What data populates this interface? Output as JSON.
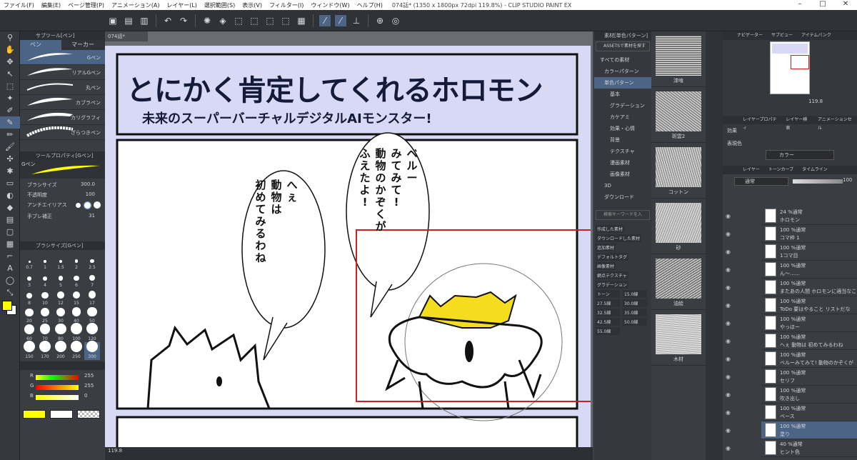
{
  "window": {
    "title": "074話* (1350 x 1800px 72dpi 119.8%) - CLIP STUDIO PAINT EX",
    "menu": [
      "ファイル(F)",
      "編集(E)",
      "ページ管理(P)",
      "アニメーション(A)",
      "レイヤー(L)",
      "選択範囲(S)",
      "表示(V)",
      "フィルター(I)",
      "ウィンドウ(W)",
      "ヘルプ(H)"
    ]
  },
  "subtool": {
    "tab_label": "サブツール[ペン]",
    "tabs": [
      "ペン",
      "マーカー"
    ],
    "brushes": [
      "Gペン",
      "リアルGペン",
      "丸ペン",
      "カブラペン",
      "カリグラフィ",
      "ざらつきペン"
    ]
  },
  "toolprop": {
    "header": "ツールプロパティ[Gペン]",
    "name": "Gペン",
    "rows": [
      {
        "label": "ブラシサイズ",
        "value": "300.0"
      },
      {
        "label": "不透明度",
        "value": "100"
      },
      {
        "label": "アンチエイリアス",
        "value": ""
      },
      {
        "label": "手ブレ補正",
        "value": "31"
      }
    ]
  },
  "brushsize": {
    "header": "ブラシサイズ[Gペン]",
    "sizes": [
      "0.7",
      "1",
      "1.5",
      "2",
      "2.5",
      "3",
      "4",
      "5",
      "6",
      "7",
      "8",
      "10",
      "12",
      "15",
      "17",
      "20",
      "25",
      "30",
      "40",
      "50",
      "60",
      "70",
      "80",
      "100",
      "120",
      "150",
      "170",
      "200",
      "250",
      "300"
    ]
  },
  "color": {
    "r_label": "R",
    "g_label": "G",
    "b_label": "B",
    "r": "255",
    "g": "255",
    "b": "0",
    "main": "#ffff00"
  },
  "canvas": {
    "tab": "074話*",
    "zoom": "119.8",
    "manga_title": "とにかく肯定してくれるホロモン",
    "manga_subtitle": "未来のスーパーバーチャルデジタルAIモンスター!",
    "bubble_left_lines": [
      "へぇ",
      "動物は",
      "初めてみるわね"
    ],
    "bubble_right_lines": [
      "ベルー",
      "みてみて!",
      "動物のかぞくが",
      "ふえたよ!"
    ]
  },
  "material": {
    "header": "素材[単色パターン]",
    "search_btn": "ASSETSで素材を探す",
    "tree": [
      "すべての素材",
      "カラーパターン",
      "単色パターン",
      "基本",
      "グラデーション",
      "カケアミ",
      "効果・心情",
      "背景",
      "テクスチャ",
      "漫画素材",
      "画像素材",
      "3D",
      "ダウンロード"
    ],
    "search_placeholder": "検索キーワードを入",
    "tags": [
      "作成した素材",
      "ダウンロードした素材",
      "追加素材",
      "デフォルトタグ",
      "画像素材",
      "網点テクスチャ",
      "グラデーション",
      "トーン",
      "15.0線",
      "27.5線",
      "30.0線",
      "32.5線",
      "35.0線",
      "42.5線",
      "50.0線",
      "55.0線"
    ],
    "items": [
      "漆喰",
      "斑雲2",
      "コットン",
      "砂",
      "油絵",
      "木材"
    ]
  },
  "navigator": {
    "tabs": [
      "ナビゲーター",
      "サブビュー",
      "アイテムバンク"
    ],
    "zoom": "119.8"
  },
  "layerprop": {
    "tabs": [
      "レイヤープロパティ",
      "レイヤー検索",
      "アニメーションセル"
    ],
    "effect": "効果",
    "color_label": "表現色",
    "color_value": "カラー"
  },
  "layers": {
    "tabs": [
      "レイヤー",
      "トーンカーブ",
      "タイムライン"
    ],
    "blend": "通常",
    "opacity": "100",
    "items": [
      {
        "a": "24 %通常",
        "b": "ホロモン"
      },
      {
        "a": "100 %通常",
        "b": "コマ枠 1"
      },
      {
        "a": "100 %通常",
        "b": "1コマ目"
      },
      {
        "a": "100 %通常",
        "b": "ん〜……"
      },
      {
        "a": "100 %通常",
        "b": "またあの人間 ホロモンに適当なこと教えて"
      },
      {
        "a": "100 %通常",
        "b": "ToDo 要はやること リストだな"
      },
      {
        "a": "100 %通常",
        "b": "やっほー"
      },
      {
        "a": "100 %通常",
        "b": "へぇ 動物は 初めてみるわね"
      },
      {
        "a": "100 %通常",
        "b": "ベルーみてみて! 動物のかぞくが ふえたよ!"
      },
      {
        "a": "100 %通常",
        "b": "セリフ"
      },
      {
        "a": "100 %通常",
        "b": "吹き出し"
      },
      {
        "a": "100 %通常",
        "b": "ベース"
      },
      {
        "a": "100 %通常",
        "b": "塗り"
      },
      {
        "a": "40 %通常",
        "b": "ヒント色"
      }
    ]
  }
}
